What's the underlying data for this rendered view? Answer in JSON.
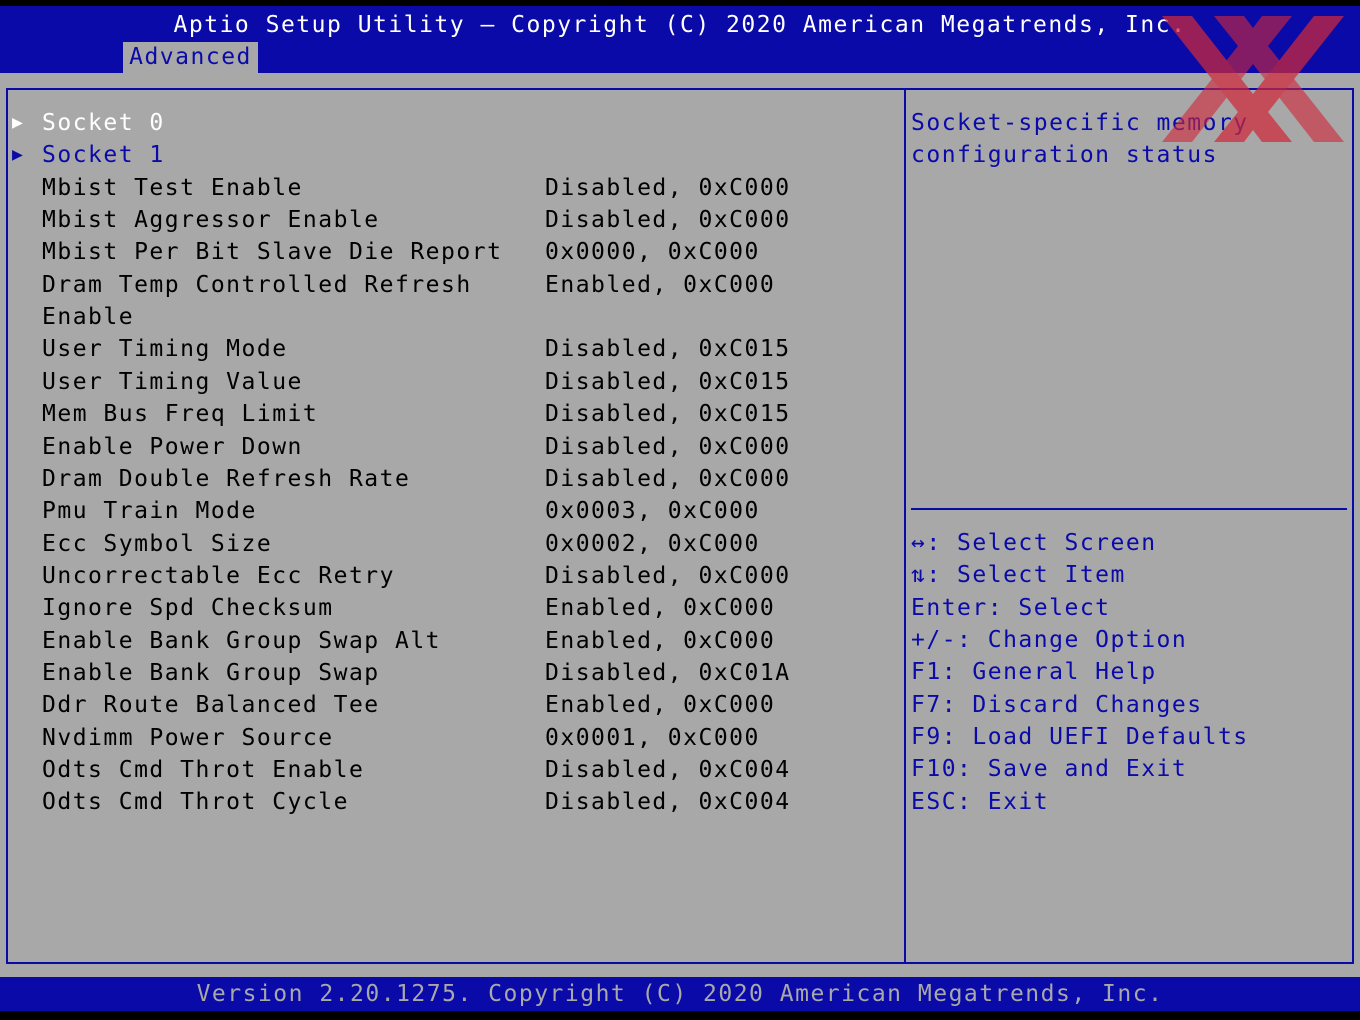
{
  "header": {
    "title": "Aptio Setup Utility – Copyright (C) 2020 American Megatrends, Inc.",
    "tab": "Advanced"
  },
  "items": [
    {
      "label": "Socket 0",
      "value": "",
      "submenu": true,
      "selected": true
    },
    {
      "label": "Socket 1",
      "value": "",
      "submenu": true,
      "selected": false
    },
    {
      "label": "Mbist Test Enable",
      "value": "Disabled, 0xC000"
    },
    {
      "label": "Mbist Aggressor Enable",
      "value": "Disabled, 0xC000"
    },
    {
      "label": "Mbist Per Bit Slave Die Report",
      "value": "0x0000, 0xC000"
    },
    {
      "label": "Dram Temp Controlled Refresh",
      "value": "Enabled, 0xC000"
    },
    {
      "label": "Enable",
      "value": ""
    },
    {
      "label": "User Timing Mode",
      "value": "Disabled, 0xC015"
    },
    {
      "label": "User Timing Value",
      "value": "Disabled, 0xC015"
    },
    {
      "label": "Mem Bus Freq Limit",
      "value": "Disabled, 0xC015"
    },
    {
      "label": "Enable Power Down",
      "value": "Disabled, 0xC000"
    },
    {
      "label": "Dram Double Refresh Rate",
      "value": "Disabled, 0xC000"
    },
    {
      "label": "Pmu Train Mode",
      "value": "0x0003, 0xC000"
    },
    {
      "label": "Ecc Symbol Size",
      "value": "0x0002, 0xC000"
    },
    {
      "label": "Uncorrectable Ecc Retry",
      "value": "Disabled, 0xC000"
    },
    {
      "label": "Ignore Spd Checksum",
      "value": "Enabled, 0xC000"
    },
    {
      "label": "Enable Bank Group Swap Alt",
      "value": "Enabled, 0xC000"
    },
    {
      "label": "Enable Bank Group Swap",
      "value": "Disabled, 0xC01A"
    },
    {
      "label": "Ddr Route Balanced Tee",
      "value": "Enabled, 0xC000"
    },
    {
      "label": "Nvdimm Power Source",
      "value": "0x0001, 0xC000"
    },
    {
      "label": "Odts Cmd Throt Enable",
      "value": "Disabled, 0xC004"
    },
    {
      "label": "Odts Cmd Throt Cycle",
      "value": "Disabled, 0xC004"
    }
  ],
  "help": {
    "description": "Socket-specific memory\nconfiguration status",
    "keys": [
      "↔: Select Screen",
      "⇅: Select Item",
      "Enter: Select",
      "+/-: Change Option",
      "F1: General Help",
      "F7: Discard Changes",
      "F9: Load UEFI Defaults",
      "F10: Save and Exit",
      "ESC: Exit"
    ]
  },
  "footer": {
    "text": "Version 2.20.1275. Copyright (C) 2020 American Megatrends, Inc."
  },
  "icons": {
    "submenu_arrow": "submenu-triangle-icon",
    "watermark": "xx-logo-icon"
  },
  "colors": {
    "blue": "#0a0aa8",
    "gray": "#a8a8a8",
    "white": "#ffffff",
    "watermark": "#d0283a"
  }
}
